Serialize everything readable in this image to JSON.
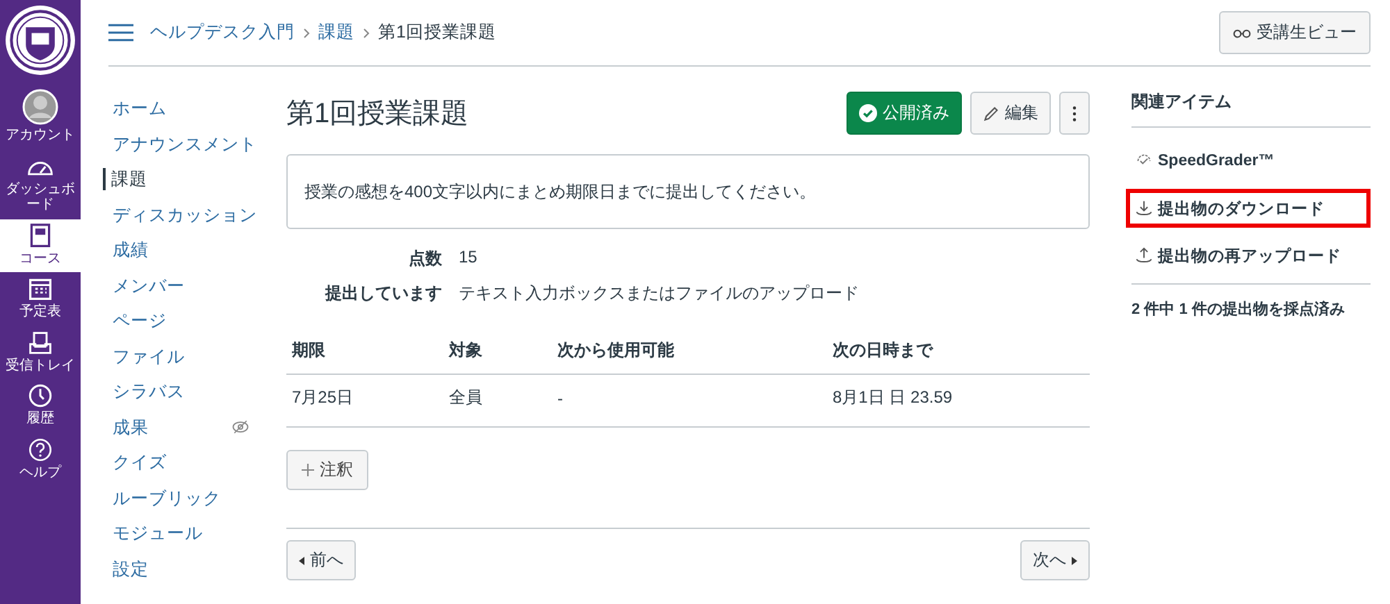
{
  "global_nav": [
    {
      "label": "アカウント",
      "kind": "account",
      "selected": false
    },
    {
      "label": "ダッシュボード",
      "kind": "dashboard",
      "selected": false
    },
    {
      "label": "コース",
      "kind": "courses",
      "selected": true
    },
    {
      "label": "予定表",
      "kind": "calendar",
      "selected": false
    },
    {
      "label": "受信トレイ",
      "kind": "inbox",
      "selected": false
    },
    {
      "label": "履歴",
      "kind": "history",
      "selected": false
    },
    {
      "label": "ヘルプ",
      "kind": "help",
      "selected": false
    }
  ],
  "breadcrumbs": [
    {
      "label": "ヘルプデスク入門",
      "current": false
    },
    {
      "label": "課題",
      "current": false
    },
    {
      "label": "第1回授業課題",
      "current": true
    }
  ],
  "student_view_button": "受講生ビュー",
  "course_nav": [
    {
      "label": "ホーム",
      "selected": false,
      "hidden": false
    },
    {
      "label": "アナウンスメント",
      "selected": false,
      "hidden": false
    },
    {
      "label": "課題",
      "selected": true,
      "hidden": false
    },
    {
      "label": "ディスカッション",
      "selected": false,
      "hidden": false
    },
    {
      "label": "成績",
      "selected": false,
      "hidden": false
    },
    {
      "label": "メンバー",
      "selected": false,
      "hidden": false
    },
    {
      "label": "ページ",
      "selected": false,
      "hidden": false
    },
    {
      "label": "ファイル",
      "selected": false,
      "hidden": false
    },
    {
      "label": "シラバス",
      "selected": false,
      "hidden": false
    },
    {
      "label": "成果",
      "selected": false,
      "hidden": true
    },
    {
      "label": "クイズ",
      "selected": false,
      "hidden": false
    },
    {
      "label": "ルーブリック",
      "selected": false,
      "hidden": false
    },
    {
      "label": "モジュール",
      "selected": false,
      "hidden": false
    },
    {
      "label": "設定",
      "selected": false,
      "hidden": false
    }
  ],
  "assignment": {
    "title": "第1回授業課題",
    "published_button": {
      "label": "公開済み",
      "on": true
    },
    "edit_button": "編集",
    "description": "授業の感想を400文字以内にまとめ期限日までに提出してください。",
    "details": [
      {
        "label": "点数",
        "value": "15"
      },
      {
        "label": "提出しています",
        "value": "テキスト入力ボックスまたはファイルのアップロード"
      }
    ],
    "table": {
      "columns": [
        "期限",
        "対象",
        "次から使用可能",
        "次の日時まで"
      ],
      "rows": [
        [
          "7月25日",
          "全員",
          "-",
          "8月1日 日 23.59"
        ]
      ]
    },
    "annotate_button": "注釈",
    "prev_button": "前へ",
    "next_button": "次へ"
  },
  "related": {
    "title": "関連アイテム",
    "items": [
      {
        "label": "SpeedGrader™",
        "kind": "grader",
        "highlighted": false
      },
      {
        "label": "提出物のダウンロード",
        "kind": "download",
        "highlighted": true
      },
      {
        "label": "提出物の再アップロード",
        "kind": "upload",
        "highlighted": false
      }
    ],
    "summary": "2 件中 1 件の提出物を採点済み"
  }
}
